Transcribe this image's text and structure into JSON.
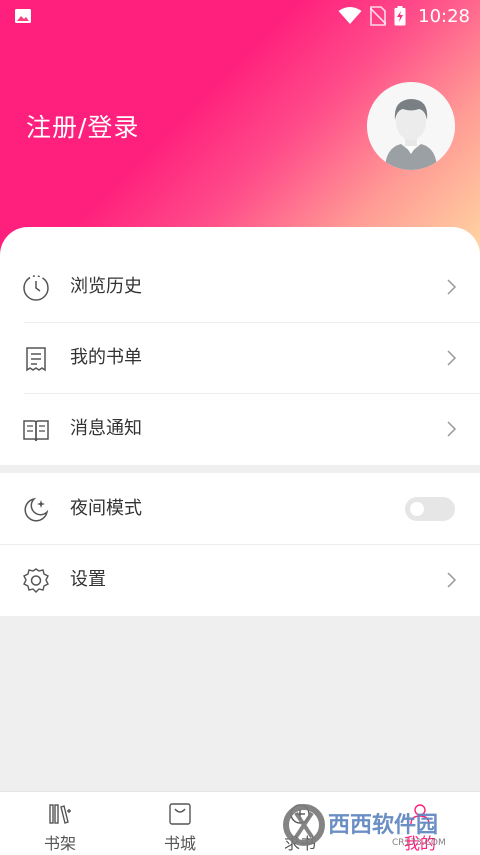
{
  "status_bar": {
    "time": "10:28",
    "icons": [
      "image-icon",
      "wifi-icon",
      "no-sim-icon",
      "battery-charging-icon"
    ]
  },
  "header": {
    "login_text": "注册/登录",
    "colors": {
      "start": "#ff1f7c",
      "mid": "#ff9b95",
      "end": "#ffd8a2"
    }
  },
  "menu": {
    "items": [
      {
        "label": "浏览历史",
        "icon": "clock-icon"
      },
      {
        "label": "我的书单",
        "icon": "receipt-icon"
      },
      {
        "label": "消息通知",
        "icon": "book-icon"
      }
    ],
    "night_mode": {
      "label": "夜间模式",
      "icon": "moon-icon",
      "enabled": false
    },
    "settings": {
      "label": "设置",
      "icon": "gear-icon"
    }
  },
  "bottom_nav": {
    "items": [
      {
        "label": "书架",
        "icon": "bookshelf-icon"
      },
      {
        "label": "书城",
        "icon": "shopping-bag-icon"
      },
      {
        "label": "求书",
        "icon": "request-icon"
      },
      {
        "label": "我的",
        "icon": "profile-icon",
        "active": true
      }
    ],
    "active_color": "#ff1f7c"
  },
  "watermark": {
    "brand": "西西软件园",
    "site": "CR173.COM"
  }
}
